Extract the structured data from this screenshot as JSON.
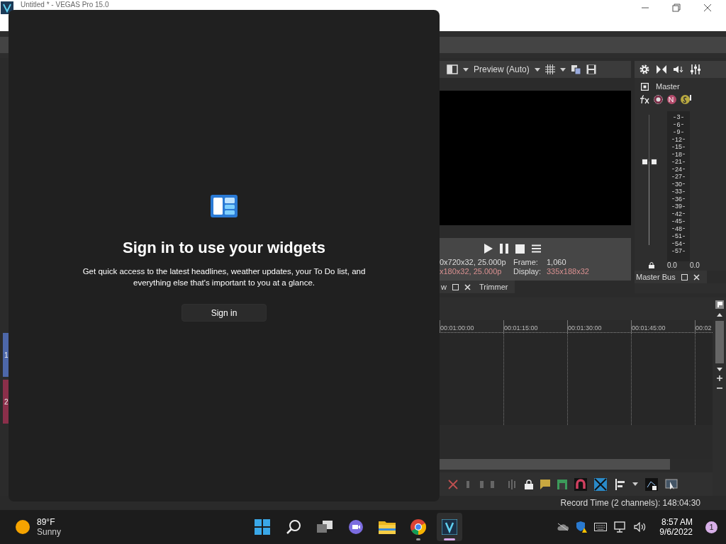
{
  "window": {
    "title": "Untitled * - VEGAS Pro 15.0"
  },
  "preview": {
    "mode": "Preview (Auto)",
    "info": [
      {
        "label": "Frame:",
        "left": "0x720x32, 25.000p",
        "value": "1,060",
        "warn": false
      },
      {
        "label": "Display:",
        "left": "x180x32, 25.000p",
        "value": "335x188x32",
        "warn": true
      }
    ],
    "tabs": [
      {
        "label": "w",
        "closable": true
      },
      {
        "label": "Trimmer",
        "closable": false
      }
    ]
  },
  "mixer": {
    "bus": "Master",
    "fader": {
      "level": 0.64
    },
    "scale": [
      "3",
      "6",
      "9",
      "12",
      "15",
      "18",
      "21",
      "24",
      "27",
      "30",
      "33",
      "36",
      "39",
      "42",
      "45",
      "48",
      "51",
      "54",
      "57"
    ],
    "readings": [
      "0.0",
      "0.0"
    ],
    "tab": "Master Bus"
  },
  "tracks": [
    {
      "label": "1",
      "color": "#4d67a9"
    },
    {
      "label": "2",
      "color": "#8a2f4a"
    }
  ],
  "timeline": {
    "ruler": [
      "00:01:00:00",
      "00:01:15:00",
      "00:01:30:00",
      "00:01:45:00",
      "00:02"
    ]
  },
  "status_bar": "Record Time (2 channels): 148:04:30",
  "widgets": {
    "heading": "Sign in to use your widgets",
    "body": "Get quick access to the latest headlines, weather updates, your To Do list, and everything else that's important to you at a glance.",
    "button": "Sign in"
  },
  "taskbar": {
    "weather": {
      "temp": "89°F",
      "condition": "Sunny"
    },
    "apps": [
      {
        "kind": "start",
        "running": false,
        "selected": false
      },
      {
        "kind": "search",
        "running": false,
        "selected": false
      },
      {
        "kind": "taskview",
        "running": false,
        "selected": false
      },
      {
        "kind": "chat",
        "running": false,
        "selected": false
      },
      {
        "kind": "explorer",
        "running": false,
        "selected": false
      },
      {
        "kind": "chrome",
        "running": true,
        "selected": false
      },
      {
        "kind": "vegas",
        "running": true,
        "selected": true
      }
    ],
    "time": "8:57 AM",
    "date": "9/6/2022",
    "notifications": "1"
  }
}
